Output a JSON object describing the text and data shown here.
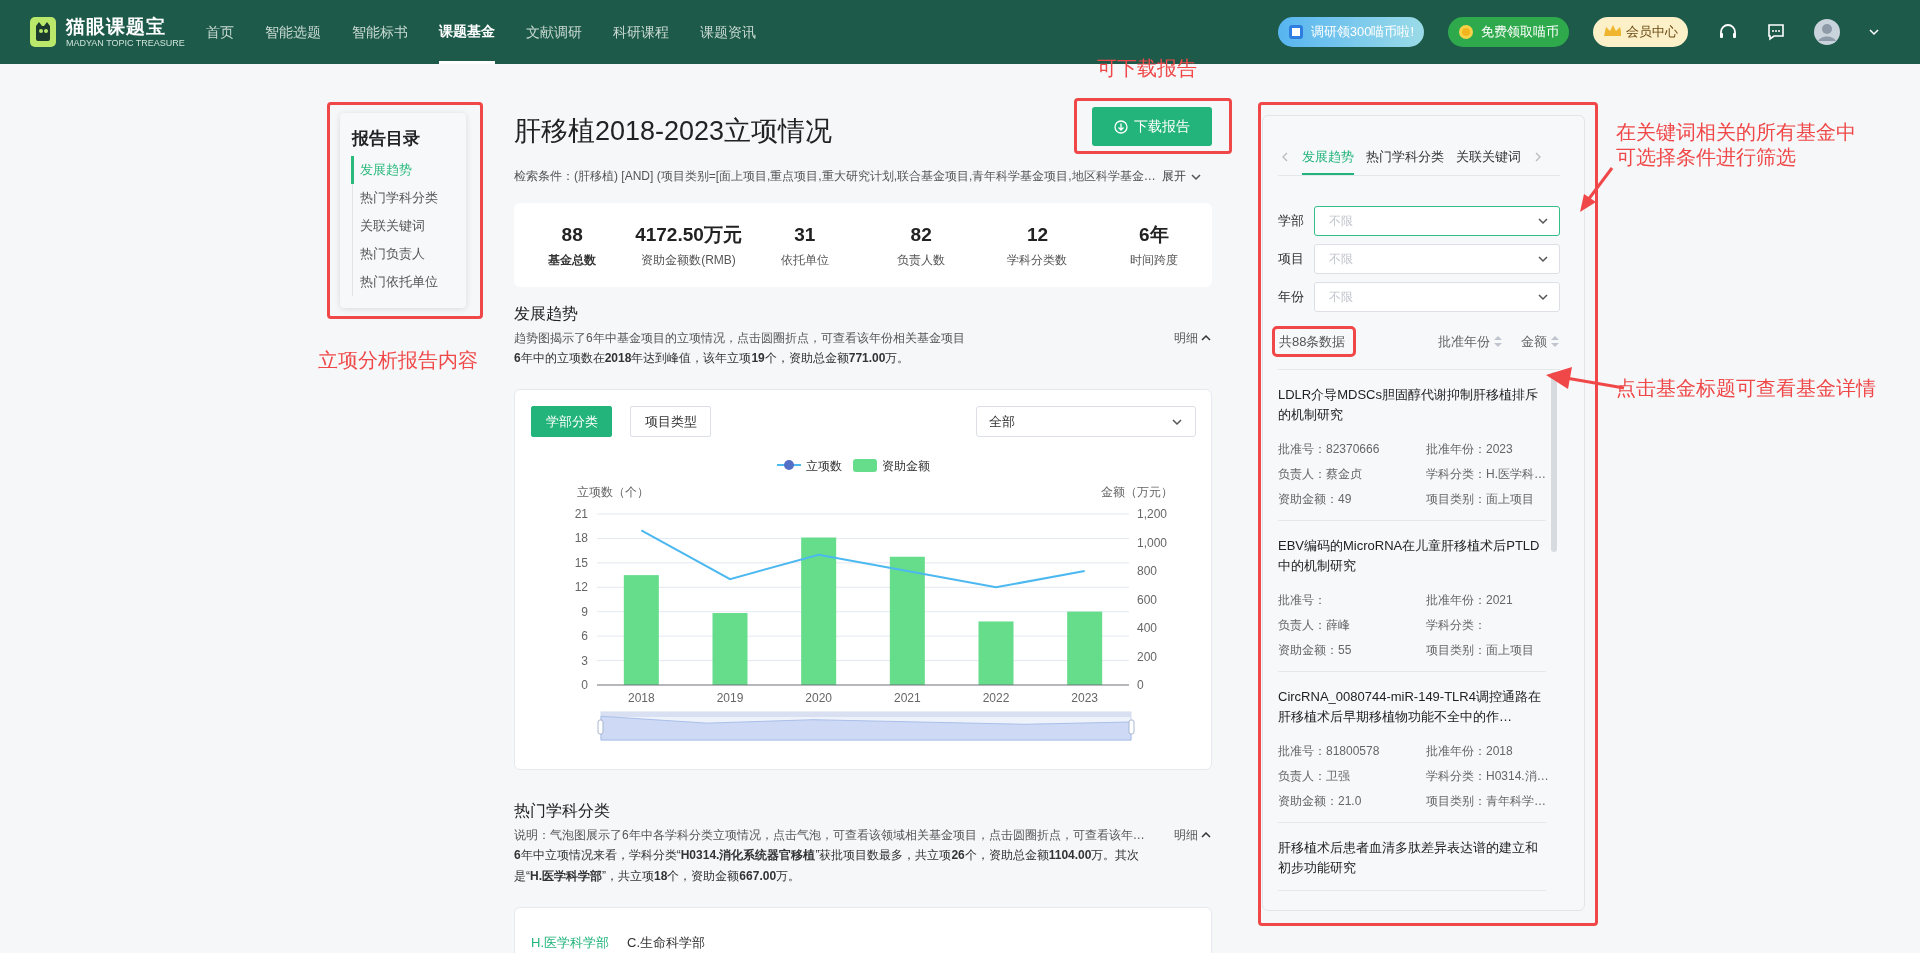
{
  "header": {
    "logo": {
      "name": "猫眼课题宝",
      "tagline": "MADYAN TOPIC TREASURE"
    },
    "nav": [
      {
        "label": "首页",
        "selected": false
      },
      {
        "label": "智能选题",
        "selected": false
      },
      {
        "label": "智能标书",
        "selected": false
      },
      {
        "label": "课题基金",
        "selected": true
      },
      {
        "label": "文献调研",
        "selected": false
      },
      {
        "label": "科研课程",
        "selected": false
      },
      {
        "label": "课题资讯",
        "selected": false
      }
    ],
    "actions": [
      {
        "kind": "survey",
        "label": "调研领300喵币啦!"
      },
      {
        "kind": "coin",
        "label": "免费领取喵币"
      },
      {
        "kind": "member",
        "label": "会员中心"
      }
    ]
  },
  "toc": {
    "title": "报告目录",
    "items": [
      {
        "label": "发展趋势",
        "selected": true
      },
      {
        "label": "热门学科分类",
        "selected": false
      },
      {
        "label": "关联关键词",
        "selected": false
      },
      {
        "label": "热门负责人",
        "selected": false
      },
      {
        "label": "热门依托单位",
        "selected": false
      }
    ]
  },
  "report": {
    "title": "肝移植2018-2023立项情况",
    "download_button": "下载报告",
    "query": "检索条件：(肝移植) [AND] (项目类别=[面上项目,重点项目,重大研究计划,联合基金项目,青年科学基金项目,地区科学基金…",
    "expand": "展开",
    "stats": [
      {
        "value": "88",
        "label": "基金总数",
        "strong": true
      },
      {
        "value": "4172.50万元",
        "label": "资助金额数(RMB)",
        "strong": false
      },
      {
        "value": "31",
        "label": "依托单位",
        "strong": false
      },
      {
        "value": "82",
        "label": "负责人数",
        "strong": false
      },
      {
        "value": "12",
        "label": "学科分类数",
        "strong": false
      },
      {
        "value": "6年",
        "label": "时间跨度",
        "strong": false
      }
    ]
  },
  "trend": {
    "heading": "发展趋势",
    "description": "趋势图揭示了6年中基金项目的立项情况，点击圆圈折点，可查看该年份相关基金项目",
    "detail_toggle": "明细",
    "summary": "**6**年中的立项数在**2018**年达到峰值，该年立项**19**个，资助总金额**771.00**万。",
    "tabs": [
      {
        "label": "学部分类",
        "selected": true
      },
      {
        "label": "项目类型",
        "selected": false
      }
    ],
    "filter": "全部",
    "chart_data": {
      "type": "bar",
      "grid": true,
      "legend": "top",
      "ylabel": "立项数（个）",
      "y2label": "金额（万元）",
      "categories": [
        "2018",
        "2019",
        "2020",
        "2021",
        "2022",
        "2023"
      ],
      "series": [
        {
          "name": "立项数",
          "type": "line",
          "color": "#4cb8f0",
          "values": [
            19,
            13,
            16,
            14,
            12,
            14
          ]
        },
        {
          "name": "资助金额",
          "axis": "y2",
          "color": "#65dd8b",
          "values": [
            771,
            505,
            1035,
            900,
            446,
            515
          ]
        }
      ],
      "ylim": [
        0,
        21
      ],
      "yticks": [
        0,
        3,
        6,
        9,
        12,
        15,
        18,
        21
      ],
      "y2lim": [
        0,
        1200
      ],
      "y2ticks": [
        0,
        200,
        400,
        600,
        800,
        {
          "value": 1000,
          "label": "1,000"
        },
        {
          "value": 1200,
          "label": "1,200"
        }
      ]
    }
  },
  "subjects": {
    "heading": "热门学科分类",
    "description": "说明：气泡图展示了6年中各学科分类立项情况，点击气泡，可查看该领域相关基金项目，点击圆圈折点，可查看该年…",
    "detail_toggle": "明细",
    "summary": "**6**年中立项情况来看，学科分类“**H0314.消化系统器官移植**”获批项目数最多，共立项**26**个，资助总金额**1104.00**万。其次是“**H.医学科学部**”，共立项**18**个，资助金额**667.00**万。",
    "tabs": [
      {
        "label": "H.医学科学部",
        "selected": true
      },
      {
        "label": "C.生命科学部",
        "selected": false
      }
    ]
  },
  "fund_panel": {
    "tabs": [
      {
        "label": "发展趋势",
        "selected": true
      },
      {
        "label": "热门学科分类",
        "selected": false
      },
      {
        "label": "关联关键词",
        "selected": false
      }
    ],
    "filters": [
      {
        "label": "学部",
        "placeholder": "不限",
        "focused": true
      },
      {
        "label": "项目",
        "placeholder": "不限",
        "focused": false
      },
      {
        "label": "年份",
        "placeholder": "不限",
        "focused": false
      }
    ],
    "count": "共88条数据",
    "sorts": [
      "批准年份",
      "金额"
    ],
    "funds": [
      {
        "title": "LDLR介导MDSCs胆固醇代谢抑制肝移植排斥的机制研究",
        "fields": [
          "批准号：82370666",
          "批准年份：2023",
          "负责人：蔡金贞",
          "学科分类：H.医学科…",
          "资助金额：49",
          "项目类别：面上项目"
        ]
      },
      {
        "title": "EBV编码的MicroRNA在儿童肝移植术后PTLD中的机制研究",
        "fields": [
          "批准号：",
          "批准年份：2021",
          "负责人：薛峰",
          "学科分类：",
          "资助金额：55",
          "项目类别：面上项目"
        ]
      },
      {
        "title": "CircRNA_0080744-miR-149-TLR4调控通路在肝移植术后早期移植物功能不全中的作…",
        "fields": [
          "批准号：81800578",
          "批准年份：2018",
          "负责人：卫强",
          "学科分类：H0314.消…",
          "资助金额：21.0",
          "项目类别：青年科学…"
        ]
      },
      {
        "title": "肝移植术后患者血清多肽差异表达谱的建立和初步功能研究"
      }
    ]
  },
  "annotations": {
    "toc": "立项分析报告内容",
    "download": "可下载报告",
    "filter": "在关键词相关的所有基金中可选择条件进行筛选",
    "detail": "点击基金标题可查看基金详情"
  }
}
